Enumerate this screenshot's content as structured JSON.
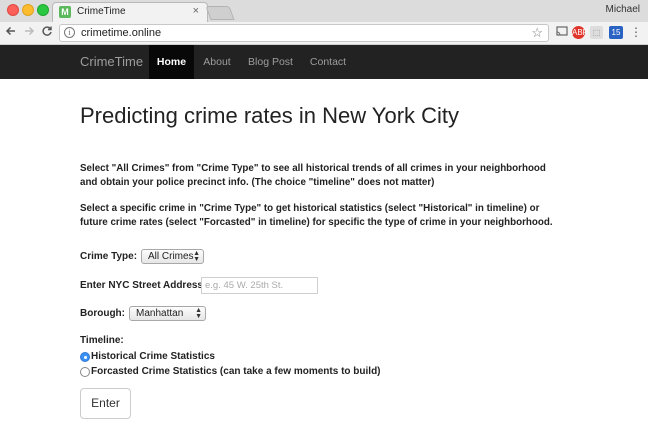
{
  "browser": {
    "tab_title": "CrimeTime",
    "tab_favicon": "M",
    "tab_close": "×",
    "profile_name": "Michael",
    "url": "crimetime.online",
    "icons": {
      "back": "back-arrow-icon",
      "forward": "forward-arrow-icon",
      "reload": "reload-icon",
      "info": "info-icon",
      "star": "star-icon",
      "cast": "cast-icon",
      "adblock": "adblock-icon",
      "extension": "extension-icon",
      "menu": "menu-icon"
    },
    "ext_abp": "ABP",
    "ext_badge": "15"
  },
  "nav": {
    "brand": "CrimeTime",
    "items": [
      {
        "label": "Home",
        "active": true
      },
      {
        "label": "About",
        "active": false
      },
      {
        "label": "Blog Post",
        "active": false
      },
      {
        "label": "Contact",
        "active": false
      }
    ]
  },
  "main": {
    "title": "Predicting crime rates in New York City",
    "para1": "Select \"All Crimes\" from \"Crime Type\" to see all historical trends of all crimes in your neighborhood and obtain your police precinct info. (The choice \"timeline\" does not matter)",
    "para2": "Select a specific crime in \"Crime Type\" to get historical statistics (select \"Historical\" in timeline) or future crime rates (select \"Forcasted\" in timeline) for specific the type of crime in your neighborhood.",
    "crime_type_label": "Crime Type:",
    "crime_type_value": "All Crimes",
    "address_label": "Enter NYC Street Address:",
    "address_placeholder": "e.g. 45 W. 25th St.",
    "borough_label": "Borough:",
    "borough_value": "Manhattan",
    "timeline_label": "Timeline:",
    "timeline_options": [
      {
        "label": "Historical Crime Statistics",
        "checked": true
      },
      {
        "label": "Forcasted Crime Statistics (can take a few moments to build)",
        "checked": false
      }
    ],
    "submit_label": "Enter"
  },
  "colors": {
    "navbar_bg": "#222222",
    "navbar_active_bg": "#080808",
    "radio_accent": "#3b90f5"
  }
}
